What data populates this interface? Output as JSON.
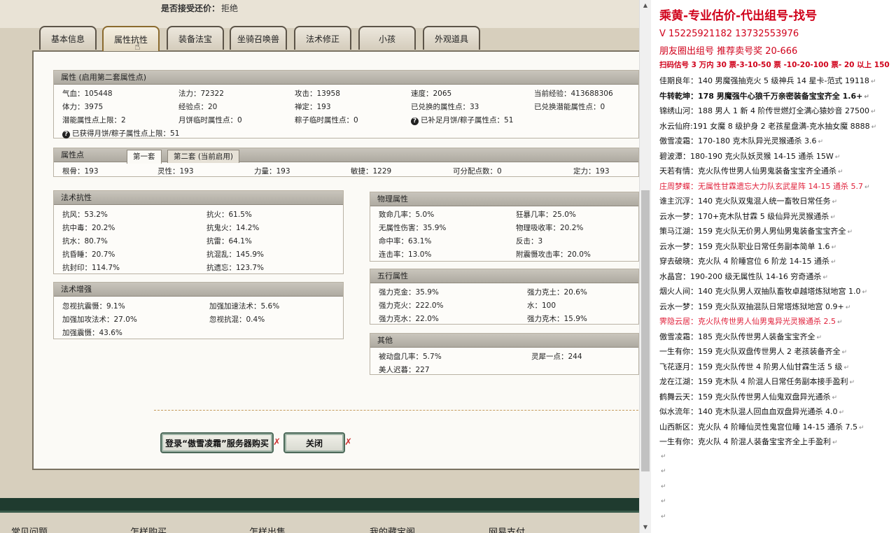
{
  "header": {
    "accept_label": "是否接受还价：",
    "accept_value": "拒绝"
  },
  "tabs": [
    "基本信息",
    "属性抗性",
    "装备法宝",
    "坐骑召唤兽",
    "法术修正",
    "小孩",
    "外观道具"
  ],
  "attr": {
    "title": "属性 (启用第二套属性点)",
    "row1": [
      "气血：105448",
      "法力：72322",
      "攻击：13958",
      "速度：2065",
      "当前经验：413688306"
    ],
    "row2": [
      "体力：3975",
      "经验点：20",
      "禅定：193",
      "已兑换的属性点：33",
      "已兑换潜能属性点：0"
    ],
    "row3": [
      "潜能属性点上限：2",
      "月饼临时属性点：0",
      "粽子临时属性点：0",
      "已补足月饼/粽子属性点：51"
    ],
    "row4": "已获得月饼/粽子属性点上限：51"
  },
  "points": {
    "title": "属性点",
    "tab1": "第一套",
    "tab2": "第二套 (当前启用)",
    "row": [
      "根骨：193",
      "灵性：193",
      "力量：193",
      "敏捷：1229",
      "可分配点数：0",
      "定力：193"
    ]
  },
  "resist": {
    "title": "法术抗性",
    "rows": [
      [
        "抗风：53.2%",
        "抗火：61.5%"
      ],
      [
        "抗中毒：20.2%",
        "抗鬼火：14.2%"
      ],
      [
        "抗水：80.7%",
        "抗雷：64.1%"
      ],
      [
        "抗昏睡：20.7%",
        "抗混乱：145.9%"
      ],
      [
        "抗封印：114.7%",
        "抗遗忘：123.7%"
      ]
    ]
  },
  "enhance": {
    "title": "法术增强",
    "rows": [
      [
        "忽视抗震慑：9.1%",
        "加强加速法术：5.6%"
      ],
      [
        "加强加攻法术：27.0%",
        "忽视抗混：0.4%"
      ],
      [
        "加强震慑：43.6%",
        ""
      ]
    ]
  },
  "physical": {
    "title": "物理属性",
    "rows": [
      [
        "致命几率：5.0%",
        "狂暴几率：25.0%"
      ],
      [
        "无属性伤害：35.9%",
        "物理吸收率：20.2%"
      ],
      [
        "命中率：63.1%",
        "反击：3"
      ],
      [
        "连击率：13.0%",
        "附震慑攻击率：20.0%"
      ]
    ]
  },
  "five": {
    "title": "五行属性",
    "rows": [
      [
        "强力克金：35.9%",
        "强力克土：20.6%"
      ],
      [
        "强力克火：222.0%",
        "水：100"
      ],
      [
        "强力克水：22.0%",
        "强力克木：15.9%"
      ]
    ]
  },
  "other": {
    "title": "其他",
    "rows": [
      [
        "被动盘几率：5.7%",
        "灵犀一点：244"
      ],
      [
        "美人迟暮：227",
        ""
      ]
    ]
  },
  "buttons": {
    "login": "登录“傲雪凌霜”服务器购买",
    "close": "关闭"
  },
  "bottom_nav": [
    "常见问题",
    "怎样购买",
    "怎样出售",
    "我的藏宝阁",
    "网易支付"
  ],
  "right": {
    "title": "乘黄-专业估价-代出组号-找号",
    "phone": "V   15225921182   13732553976",
    "line3": "朋友圈出组号  推荐卖号奖 20-666",
    "line4": "扫码估号 3 万内 30 票-3-10-50 票 -10-20-100 票- 20 以上 150",
    "items": [
      "佳期良年：140 男魔强抽克火 5 级神兵 14 星卡-范式 19118",
      "牛转乾坤：178 男魔强牛心狼千万亲密装备宝宝齐全 1.6+",
      "锦绣山河：188 男人 1 新 4 阶传世燃灯全满心猿妙音 27500",
      "水云仙府:191 女魔 8 级护身 2 老孩星盘满-克水抽女魔 8888",
      "傲雪凌霜：170-180 克木队异光灵猴通杀 3.6",
      "碧波潭：180-190 克火队妖灵猴 14-15 通杀 15W",
      "天若有情：克火队传世男人仙男鬼装备宝宝齐全通杀",
      "庄周梦蝶：无属性甘霖遗忘大力队玄武星阵 14-15 通杀 5.7",
      "谁主沉浮：140 克火队双鬼混人统一畜牧日常任务",
      "云水一梦：170+克木队甘霖 5 级仙异光灵猴通杀",
      "策马江湖：159 克火队无价男人男仙男鬼装备宝宝齐全",
      "云水一梦：159 克火队职业日常任务副本简单 1.6",
      "穿去破晓：克火队 4 阶睡宫位 6 阶龙 14-15 通杀",
      "水晶宫：190-200 级无属性队 14-16 穷奇通杀",
      "烟火人间：140 克火队男人双抽队畜牧卓越塔炼狱地宫 1.0",
      "云水一梦：159 克火队双抽混队日常塔炼狱地宫 0.9+",
      "霁隐云居：克火队传世男人仙男鬼异光灵猴通杀 2.5",
      "傲雪凌霜：185 克火队传世男人装备宝宝齐全",
      "一生有你：159 克火队双盘传世男人 2 老孩装备齐全",
      "飞花逐月：159 克火队传世 4 阶男人仙甘霖生活 5 级",
      "龙在江湖：159 克木队 4 阶混人日常任务副本接手盈利",
      "鹤舞云天：159 克火队传世男人仙鬼双盘异光通杀",
      "似水流年：140 克木队混人回血血双盘异光通杀 4.0",
      "山西新区：克火队 4 阶睡仙灵性鬼宫位睡 14-15 通杀 7.5",
      "一生有你：克火队 4 阶混人装备宝宝齐全上手盈利"
    ],
    "marker": "↵"
  },
  "colors": {
    "title_red": "#d0021b",
    "line_red": "#e0203a",
    "accent_gold": "#8b6b2e",
    "bottom_green": "#1f3b2f"
  }
}
